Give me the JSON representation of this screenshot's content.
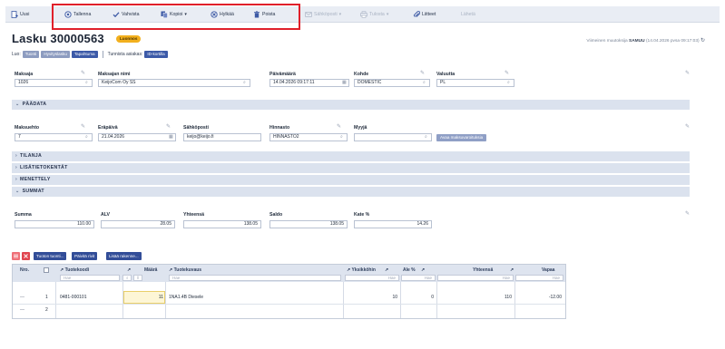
{
  "toolbar": {
    "new_label": "Uusi",
    "save_label": "Tallenna",
    "approve_label": "Vahvista",
    "copy_label": "Kopioi",
    "reject_label": "Hylkää",
    "delete_label": "Poista",
    "email_label": "Sähköposti",
    "print_label": "Tulosta",
    "attachments_label": "Liitteet",
    "more_label": "Lähetä"
  },
  "header": {
    "title": "Lasku 30000563",
    "status": "Luonnos",
    "last_edit_prefix": "Viimeinen muutoksija",
    "last_edit_user": "SAMUU",
    "last_edit_time": "(14.04.2026 pvsa 09:17:03)"
  },
  "links": {
    "prefix": "Luo:",
    "items": [
      "Tuonti",
      "Hyvityslasku",
      "Tapahtuma"
    ],
    "customer_label": "Tunnista asiakas:",
    "id_button": "ID-kortilla"
  },
  "fields": {
    "customer": {
      "label": "Maksaja",
      "value": "1026"
    },
    "customer_name": {
      "label": "Maksajan nimi",
      "value": "KeijoCom Oy SS"
    },
    "date": {
      "label": "Päivämäärä",
      "value": "14.04.2026 09:17:11"
    },
    "object": {
      "label": "Kohde",
      "value": "DOMESTIC"
    },
    "currency": {
      "label": "Valuutta",
      "value": "PL"
    }
  },
  "sections": {
    "main": "PÄÄDATA",
    "status": "TILANJA",
    "extra": "LISÄTIETOKENTÄT",
    "procedure": "MENETTELY",
    "summary": "SUMMAT"
  },
  "maindata": {
    "payment_terms": {
      "label": "Maksuehto",
      "value": "7"
    },
    "due_date": {
      "label": "Eräpäivä",
      "value": "21.04.2026"
    },
    "email": {
      "label": "Sähköposti",
      "value": "keijo@keijo.fi"
    },
    "price_list": {
      "label": "Hinnasto",
      "value": "HINNASTO2"
    },
    "seller": {
      "label": "Myyjä",
      "value": ""
    },
    "open_button": "Avaa maksuvaroituksia"
  },
  "summary": {
    "sum": {
      "label": "Summa",
      "value": "110.00"
    },
    "vat": {
      "label": "ALV",
      "value": "28.05"
    },
    "total": {
      "label": "Yhteensä",
      "value": "138.05"
    },
    "balance": {
      "label": "Saldo",
      "value": "138.05"
    },
    "rate": {
      "label": "Kate %",
      "value": "14.26"
    }
  },
  "grid_buttons": [
    "Tuoton tuonti...",
    "Päivitä rivit",
    "Lisää rakenne..."
  ],
  "grid": {
    "columns": [
      "Nro.",
      "Tuotekoodi",
      "Määrä",
      "Tuotekuvaus",
      "Yksikköhin",
      "Ale %",
      "Yhteensä",
      "Vapaa"
    ],
    "filter_placeholder": "Hae",
    "rows": [
      {
        "num": "1",
        "code": "0481-000101",
        "qty": "11",
        "desc": "1NA1.4B Diesele",
        "unit_price": "10",
        "discount": "0",
        "total": "110",
        "free": "-12.00"
      },
      {
        "num": "2",
        "code": "",
        "qty": "",
        "desc": "",
        "unit_price": "",
        "discount": "",
        "total": "",
        "free": ""
      }
    ]
  },
  "colors": {
    "accent": "#324d98",
    "highlight": "#e0202a",
    "status_badge": "#f2b01e"
  }
}
